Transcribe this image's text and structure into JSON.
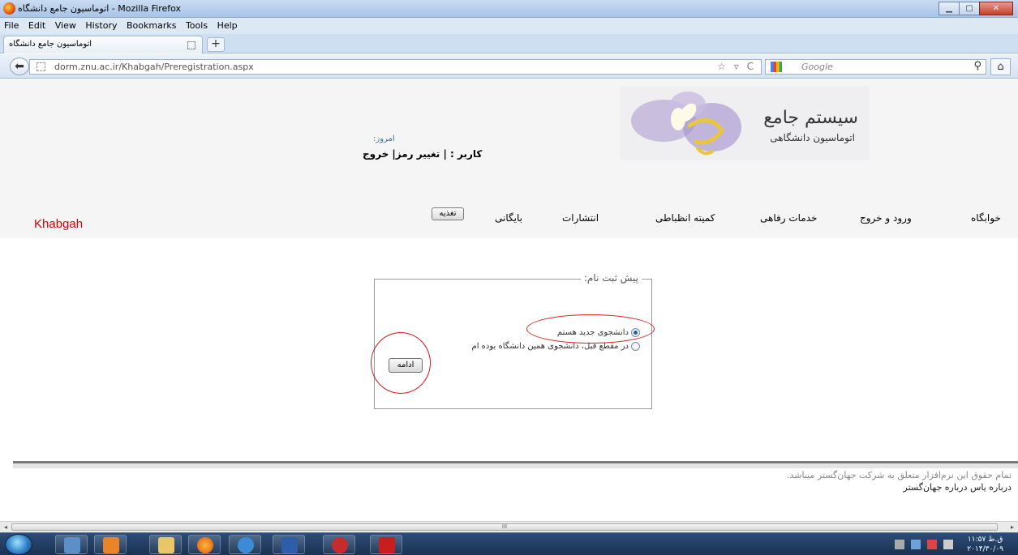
{
  "window": {
    "title": "اتوماسیون جامع دانشگاه - Mozilla Firefox",
    "minimize": "▁",
    "maximize": "▢",
    "close": "✕"
  },
  "menubar": [
    "File",
    "Edit",
    "View",
    "History",
    "Bookmarks",
    "Tools",
    "Help"
  ],
  "tab": {
    "label": "اتوماسیون جامع دانشگاه",
    "new_tab": "+"
  },
  "nav": {
    "back": "⬅",
    "url": "dorm.znu.ac.ir/Khabgah/Preregistration.aspx",
    "url_icons": "☆ ▿ C",
    "search_placeholder": "Google",
    "search_icon": "⚲",
    "home": "⌂"
  },
  "header": {
    "system_title": "سیستم جامع",
    "system_subtitle": "اتوماسیون دانشگاهی",
    "today_label": "امروز:",
    "user_line": "کاربر : | تغییر رمز| خروج"
  },
  "menu": {
    "brand": "Khabgah",
    "items": [
      "خوابگاه",
      "ورود و خروج",
      "خدمات رفاهی",
      "کمیته انظباطی",
      "انتشارات",
      "بایگانی"
    ],
    "food_button": "تغذیه"
  },
  "form": {
    "legend": "پیش ثبت نام:",
    "options": [
      {
        "label": "دانشجوی جدید هستم",
        "checked": true
      },
      {
        "label": "در مقطع قبل، دانشجوی همین دانشگاه بوده ام",
        "checked": false
      }
    ],
    "continue_button": "ادامه"
  },
  "footer": {
    "copyright": "تمام حقوق این نرم‌افزار متعلق به شرکت جهان‌گستر میباشد.",
    "links": "درباره یاس درباره جهان‌گستر"
  },
  "scrollbar": {
    "left": "◂",
    "right": "▸",
    "grip": "III"
  },
  "taskbar": {
    "clock_time": "۱۱:۵۷ ق.ظ",
    "clock_date": "۲۰۱۴/۳۰/۰۹"
  },
  "colors": {
    "brand_red": "#e00000",
    "annotation_red": "#d21d1d",
    "link_blue": "#3a6fb3"
  }
}
